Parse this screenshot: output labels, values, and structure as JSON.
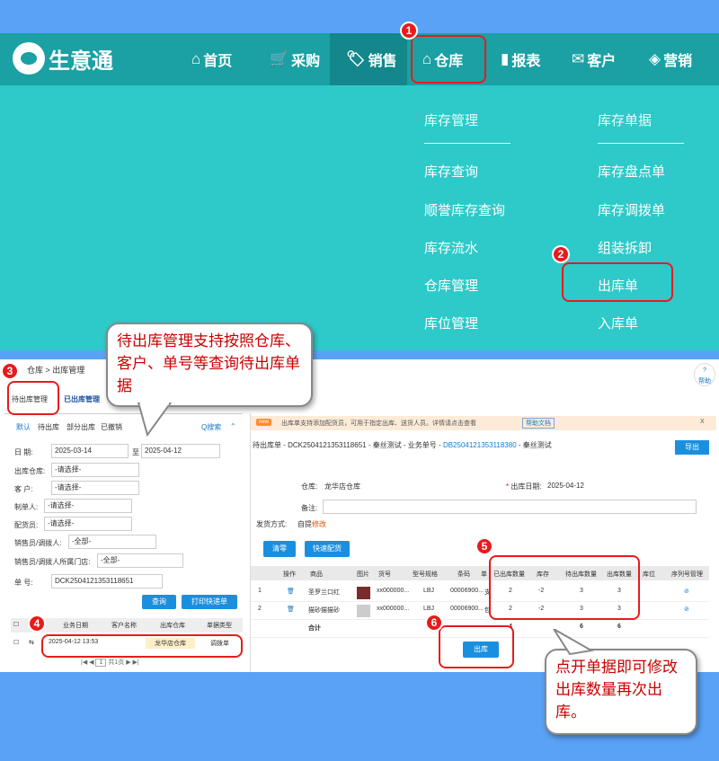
{
  "nav": {
    "logo": "生意通",
    "items": [
      {
        "label": "首页",
        "icon": "home-icon"
      },
      {
        "label": "采购",
        "icon": "cart-icon"
      },
      {
        "label": "销售",
        "icon": "tag-icon"
      },
      {
        "label": "仓库",
        "icon": "warehouse-icon"
      },
      {
        "label": "报表",
        "icon": "clipboard-icon"
      },
      {
        "label": "客户",
        "icon": "mail-icon"
      },
      {
        "label": "营销",
        "icon": "marketing-tag-icon"
      }
    ]
  },
  "dropdown": {
    "col1": {
      "heading": "库存管理",
      "items": [
        "库存查询",
        "顺誉库存查询",
        "库存流水",
        "仓库管理",
        "库位管理"
      ]
    },
    "col2": {
      "heading": "库存单据",
      "items": [
        "库存盘点单",
        "库存调拨单",
        "组装拆卸",
        "出库单",
        "入库单"
      ]
    }
  },
  "steps": [
    "1",
    "2",
    "3",
    "4",
    "5",
    "6"
  ],
  "callouts": {
    "top": "待出库管理支持按照仓库、客户、单号等查询待出库单据",
    "bottom": "点开单据即可修改出库数量再次出库。"
  },
  "shot": {
    "breadcrumb": "仓库 > 出库管理",
    "help": "帮助",
    "tabs": [
      "待出库管理",
      "已出库管理"
    ],
    "filter_tabs": [
      "默认",
      "待出库",
      "部分出库",
      "已撤销"
    ],
    "search_link": "Q搜索",
    "date_label": "日 期:",
    "date_from": "2025-03-14",
    "date_to_sep": "至",
    "date_to": "2025-04-12",
    "fields": [
      {
        "label": "出库仓库:",
        "value": "-请选择-"
      },
      {
        "label": "客 户:",
        "value": "-请选择-"
      },
      {
        "label": "制单人:",
        "value": "-请选择-"
      },
      {
        "label": "配货员:",
        "value": "-请选择-"
      },
      {
        "label": "销售员/调拨人:",
        "value": "-全部-"
      },
      {
        "label": "销售员/调拨人所属门店:",
        "value": "-全部-"
      }
    ],
    "order_label": "单 号:",
    "order_value": "DCK2504121353118651",
    "query_btn": "查询",
    "print_btn": "打印快递单",
    "left_table": {
      "headers": [
        "业务日期",
        "客户名称",
        "出库仓库",
        "单据类型"
      ],
      "row": {
        "date": "2025-04-12 13:53",
        "warehouse": "龙华店仓库",
        "type": "调拨单"
      }
    },
    "pager": "共1页",
    "pager_page": "1",
    "notice": {
      "badge": "new",
      "text": "出库单支持添加配货员，可用于指定出库、送货人员。详情请点击查看",
      "link": "帮助文档",
      "close": "X"
    },
    "detail": {
      "title_prefix": "待出库单 - DCK2504121353118651 - 秦丝测试 - 业务单号 -",
      "biz_no": "DB2504121353118380",
      "title_suffix": "- 秦丝测试",
      "export_btn": "导出",
      "warehouse_label": "仓库:",
      "warehouse": "龙华店仓库",
      "date_label": "出库日期:",
      "date": "2025-04-12",
      "note_label": "备注:",
      "ship_label": "发货方式:",
      "ship_value": "自提",
      "ship_edit": "修改",
      "clear_btn": "清零",
      "quick_btn": "快速配货",
      "headers": [
        "操作",
        "商品",
        "图片",
        "货号",
        "型号规格",
        "条码",
        "单",
        "已出库数量",
        "库存",
        "待出库数量",
        "出库数量",
        "库位",
        "序列号管理"
      ],
      "rows": [
        {
          "no": "1",
          "product": "圣罗兰口红",
          "sku": "xx000000...",
          "spec": "LBJ",
          "barcode": "00006900...",
          "unit": "支",
          "shipped": "2",
          "stock": "-2",
          "pending": "3",
          "qty": "3"
        },
        {
          "no": "2",
          "product": "猫砂猫猫砂",
          "sku": "xx000000...",
          "spec": "LBJ",
          "barcode": "00006900...",
          "unit": "包",
          "shipped": "2",
          "stock": "-2",
          "pending": "3",
          "qty": "3"
        }
      ],
      "total_label": "合计",
      "totals": {
        "shipped": "4",
        "pending": "6",
        "qty": "6"
      },
      "ship_btn": "出库"
    }
  }
}
